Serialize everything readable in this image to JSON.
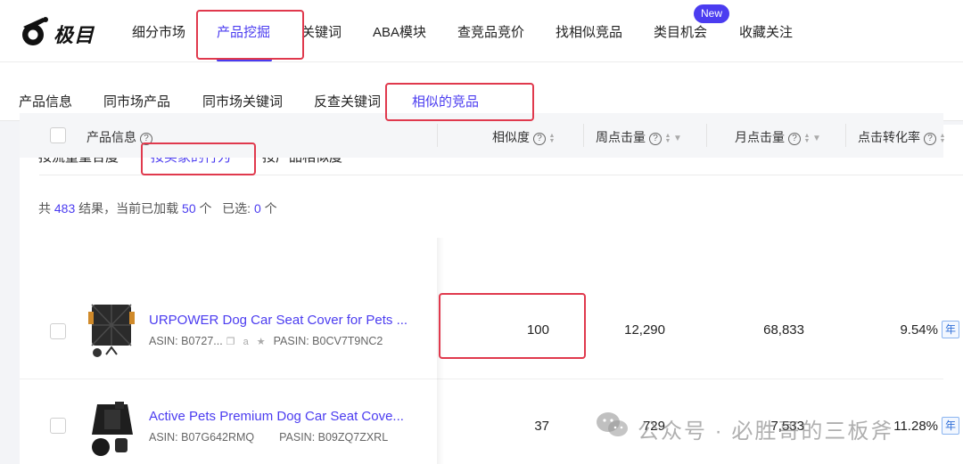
{
  "brand": {
    "name": "极目"
  },
  "top_nav": {
    "items": [
      "细分市场",
      "产品挖掘",
      "关键词",
      "ABA模块",
      "查竞品竞价",
      "找相似竞品",
      "类目机会",
      "收藏关注"
    ],
    "active": "产品挖掘",
    "new_badge": "New"
  },
  "sub_nav": {
    "items": [
      "产品信息",
      "同市场产品",
      "同市场关键词",
      "反查关键词",
      "相似的竞品"
    ],
    "active": "相似的竞品"
  },
  "mode_tabs": {
    "items": [
      "按流量重合度",
      "按买家的行为",
      "按产品相似度"
    ],
    "active": "按买家的行为"
  },
  "summary": {
    "prefix": "共",
    "total": "483",
    "mid": "结果，当前已加载",
    "loaded": "50",
    "unit1": "个",
    "selected_label": "已选:",
    "selected": "0",
    "unit2": "个"
  },
  "table": {
    "columns": [
      "产品信息",
      "相似度",
      "周点击量",
      "月点击量",
      "点击转化率"
    ],
    "rows": [
      {
        "title": "URPOWER Dog Car Seat Cover for Pets ...",
        "asin": "ASIN: B0727...",
        "pasin": "PASIN: B0CV7T9NC2",
        "similarity": "100",
        "weekly_clicks": "12,290",
        "monthly_clicks": "68,833",
        "conversion": "9.54%",
        "badge": "年"
      },
      {
        "title": "Active Pets Premium Dog Car Seat Cove...",
        "asin": "ASIN: B07G642RMQ",
        "pasin": "PASIN: B09ZQ7ZXRL",
        "similarity": "37",
        "weekly_clicks": "729",
        "monthly_clicks": "7,533",
        "conversion": "11.28%",
        "badge": "年"
      }
    ]
  },
  "watermark": {
    "text": "公众号 · 必胜哥的三板斧"
  },
  "colors": {
    "accent": "#4b3cf0",
    "annotation": "#e0394d"
  }
}
